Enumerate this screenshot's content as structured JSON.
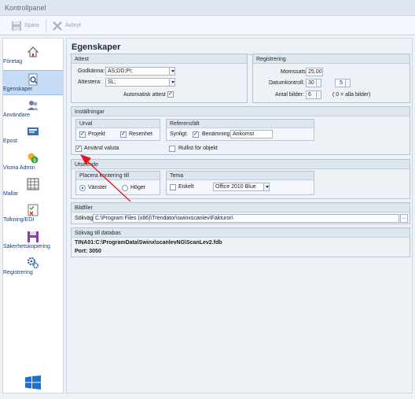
{
  "window": {
    "title": "Kontrollpanel"
  },
  "toolbar": {
    "save_label": "Spara",
    "cancel_label": "Avbryt"
  },
  "sidebar": {
    "items": [
      {
        "label": "Företag",
        "icon": "home-icon"
      },
      {
        "label": "Egenskaper",
        "icon": "properties-icon",
        "active": true
      },
      {
        "label": "Användare",
        "icon": "users-icon"
      },
      {
        "label": "Epost",
        "icon": "mail-icon"
      },
      {
        "label": "Visma Admin",
        "icon": "coins-icon"
      },
      {
        "label": "Mallar",
        "icon": "grid-icon"
      },
      {
        "label": "Tolkning/EDI",
        "icon": "checklist-icon"
      },
      {
        "label": "Säkerhetskopiering",
        "icon": "floppy-icon"
      },
      {
        "label": "Registrering",
        "icon": "gears-icon"
      }
    ]
  },
  "main": {
    "heading": "Egenskaper",
    "attest": {
      "title": "Attest",
      "godkanna_label": "Godkänna:",
      "godkanna_value": "AS;DD;PI;",
      "attestera_label": "Attestera:",
      "attestera_value": "SL;",
      "auto_label": "Automatisk attest",
      "auto_checked": true
    },
    "registrering": {
      "title": "Registrering",
      "momssats_label": "Momssats:",
      "momssats_value": "25,00",
      "datumkontroll_label": "Datumkontroll:",
      "datumkontroll_value1": "30",
      "datumkontroll_value2": "5",
      "antal_label": "Antal bilder:",
      "antal_value": "6",
      "antal_hint": "( 0 = alla bilder)"
    },
    "installningar": {
      "title": "Inställningar",
      "urval_title": "Urval",
      "projekt_label": "Projekt",
      "projekt_checked": true,
      "resenhet_label": "Resenhet",
      "resenhet_checked": true,
      "referens_title": "Referensfält",
      "synligt_label": "Synligt:",
      "synligt_checked": true,
      "benamning_label": "Benämning:",
      "benamning_value": "Ankomst",
      "valuta_label": "Använd valuta",
      "valuta_checked": true,
      "rullist_label": "Rullist för objekt",
      "rullist_checked": false
    },
    "utseende": {
      "title": "Utseende",
      "placera_title": "Placera kontering till",
      "vanster_label": "Vänster",
      "hoger_label": "Höger",
      "selected": "vanster",
      "tema_title": "Tema",
      "enkelt_label": "Enkelt",
      "enkelt_checked": false,
      "tema_value": "Office 2010 Blue"
    },
    "bildfiler": {
      "title": "Bildfiler",
      "sokvag_label": "Sökväg:",
      "sokvag_value": "C:\\Program Files (x86)\\Trendator\\swinxscanlev\\Fakturor\\",
      "browse_label": "..."
    },
    "databas": {
      "title": "Sökväg till databas",
      "path": "TINA01:C:\\ProgramData\\Swinx\\scanlevNG\\ScanLev2.fdb",
      "port": "Port: 3050"
    }
  },
  "colors": {
    "accent": "#c6dcf5",
    "annotation_arrow": "#e0161e"
  }
}
